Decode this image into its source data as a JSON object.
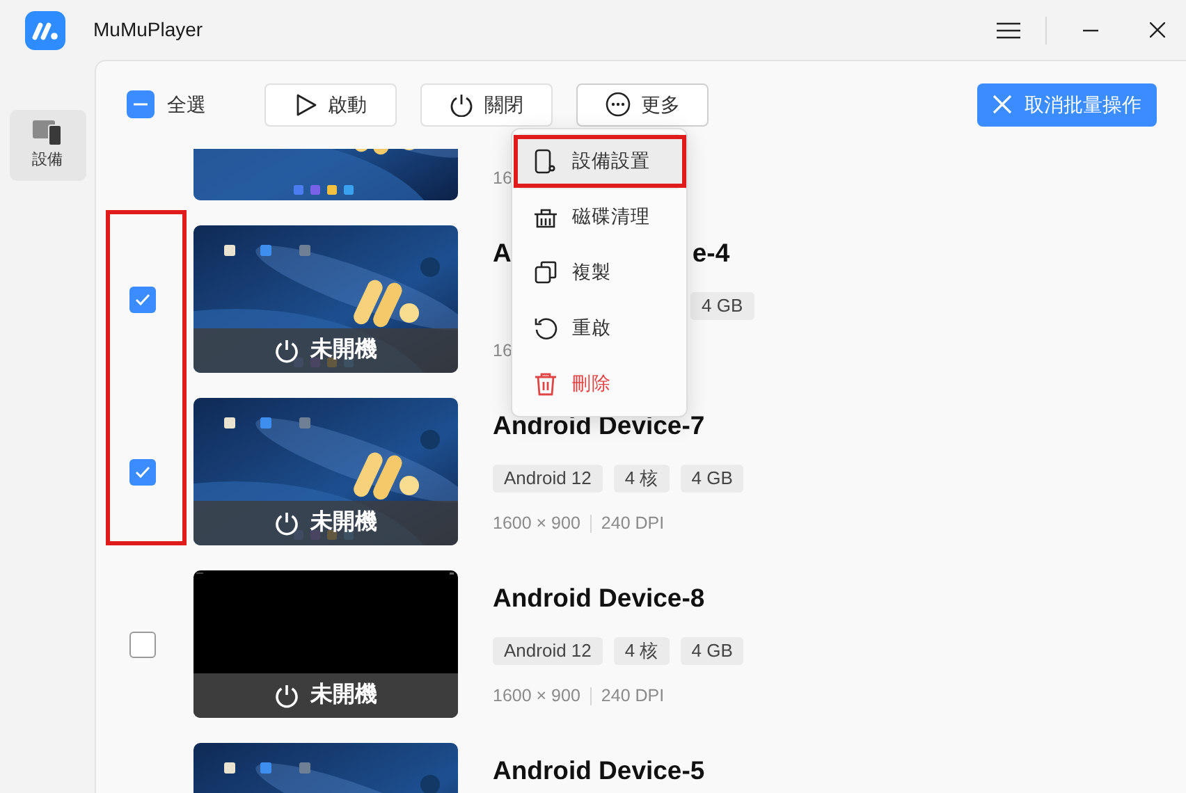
{
  "window": {
    "title": "MuMuPlayer"
  },
  "sidebar": {
    "items": [
      {
        "label": "設備",
        "selected": true
      }
    ]
  },
  "toolbar": {
    "select_all": {
      "label": "全選",
      "indeterminate": true
    },
    "buttons": [
      {
        "label": "啟動",
        "kind": "play"
      },
      {
        "label": "關閉",
        "kind": "power"
      },
      {
        "label": "更多",
        "kind": "more",
        "expanded": true
      }
    ],
    "cancel_button": "取消批量操作"
  },
  "menu": {
    "items": [
      {
        "label": "設備設置",
        "kind": "settings",
        "highlighted": true
      },
      {
        "label": "磁碟清理",
        "kind": "clean",
        "highlighted": false
      },
      {
        "label": "複製",
        "kind": "copy",
        "highlighted": false
      },
      {
        "label": "重啟",
        "kind": "restart",
        "highlighted": false
      },
      {
        "label": "刪除",
        "kind": "delete",
        "highlighted": false,
        "danger": true
      }
    ]
  },
  "devices": [
    {
      "kind": "top-cut",
      "screen_blank": false,
      "specs": [
        "16"
      ]
    },
    {
      "kind": "covered",
      "checked": true,
      "screen_blank": false,
      "status": "未開機",
      "name_parts": [
        "A",
        "e-4"
      ],
      "tags": [
        "4 GB"
      ],
      "specs": [
        "16"
      ]
    },
    {
      "kind": "full",
      "checked": true,
      "screen_blank": false,
      "status": "未開機",
      "name_parts": [
        "Android Device-7"
      ],
      "tags": [
        "Android 12",
        "4 核",
        "4 GB"
      ],
      "specs": [
        "1600 × 900",
        "240 DPI"
      ]
    },
    {
      "kind": "full",
      "checked": false,
      "screen_blank": true,
      "status": "未開機",
      "name_parts": [
        "Android Device-8"
      ],
      "tags": [
        "Android 12",
        "4 核",
        "4 GB"
      ],
      "specs": [
        "1600 × 900",
        "240 DPI"
      ]
    },
    {
      "kind": "bottom-cut",
      "screen_blank": false,
      "name_parts": [
        "Android Device-5"
      ]
    }
  ]
}
